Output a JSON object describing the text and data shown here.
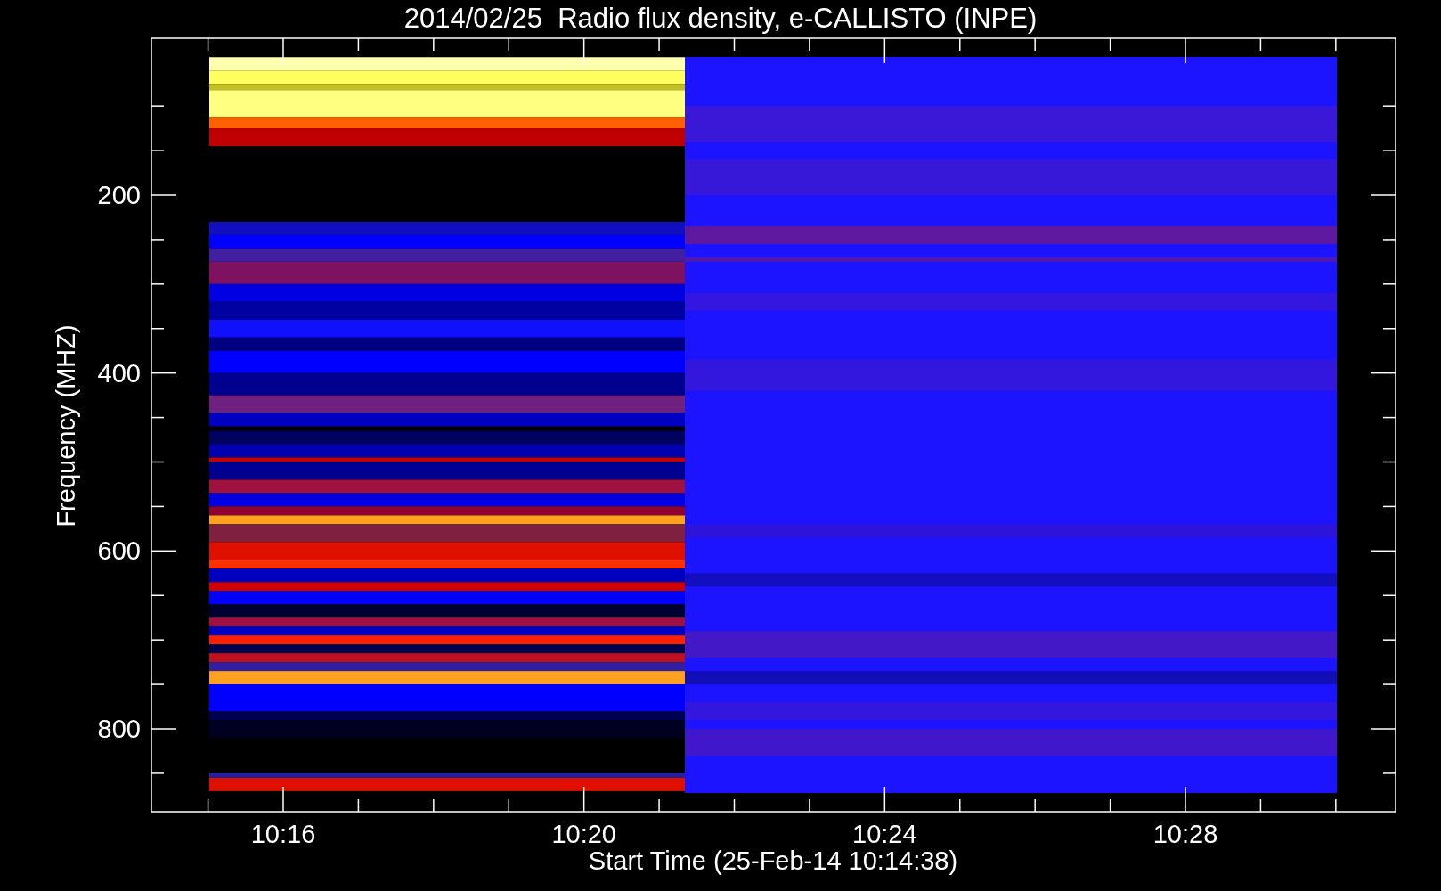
{
  "plot": {
    "title": "2014/02/25  Radio flux density, e-CALLISTO (INPE)",
    "y_axis": {
      "label": "Frequency (MHZ)",
      "ticks": [
        "200",
        "400",
        "600",
        "800"
      ]
    },
    "x_axis": {
      "label": "Start Time (25-Feb-14 10:14:38)",
      "ticks": [
        "10:16",
        "10:20",
        "10:24",
        "10:28"
      ]
    }
  }
}
